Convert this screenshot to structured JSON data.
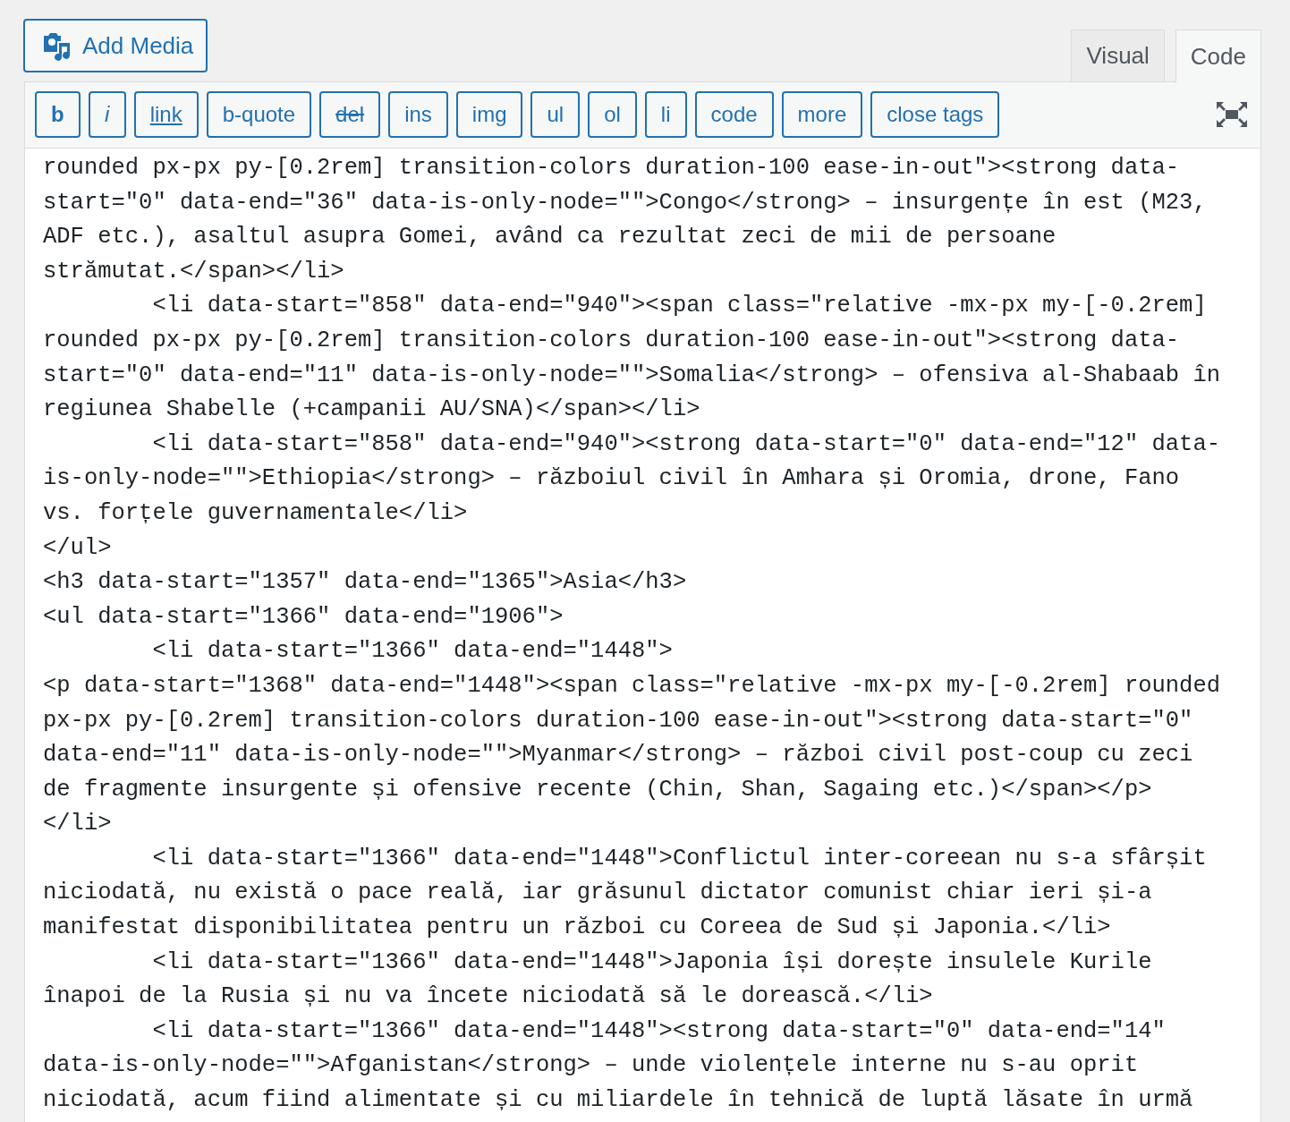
{
  "add_media_button": {
    "label": "Add Media"
  },
  "tabs": [
    {
      "label": "Visual",
      "selected": false
    },
    {
      "label": "Code",
      "selected": true
    }
  ],
  "toolbar": [
    {
      "label": "b",
      "kind": "bold"
    },
    {
      "label": "i",
      "kind": "italic"
    },
    {
      "label": "link",
      "kind": "underline"
    },
    {
      "label": "b-quote",
      "kind": "plain"
    },
    {
      "label": "del",
      "kind": "strike"
    },
    {
      "label": "ins",
      "kind": "plain"
    },
    {
      "label": "img",
      "kind": "plain"
    },
    {
      "label": "ul",
      "kind": "plain"
    },
    {
      "label": "ol",
      "kind": "plain"
    },
    {
      "label": "li",
      "kind": "plain"
    },
    {
      "label": "code",
      "kind": "plain"
    },
    {
      "label": "more",
      "kind": "plain"
    },
    {
      "label": "close tags",
      "kind": "plain"
    }
  ],
  "code_lines": [
    "rounded px-px py-[0.2rem] transition-colors duration-100 ease-in-out\"><strong data-",
    "start=\"0\" data-end=\"36\" data-is-only-node=\"\">Congo</strong> – insurgențe în est (M23,",
    "ADF etc.), asaltul asupra Gomei, având ca rezultat zeci de mii de persoane",
    "strămutat.</span></li>",
    "        <li data-start=\"858\" data-end=\"940\"><span class=\"relative -mx-px my-[-0.2rem]",
    "rounded px-px py-[0.2rem] transition-colors duration-100 ease-in-out\"><strong data-",
    "start=\"0\" data-end=\"11\" data-is-only-node=\"\">Somalia</strong> – ofensiva al-Shabaab în",
    "regiunea Shabelle (+campanii AU/SNA)</span></li>",
    "        <li data-start=\"858\" data-end=\"940\"><strong data-start=\"0\" data-end=\"12\" data-",
    "is-only-node=\"\">Ethiopia</strong> – războiul civil în Amhara și Oromia, drone, Fano",
    "vs. forțele guvernamentale</li>",
    "</ul>",
    "<h3 data-start=\"1357\" data-end=\"1365\">Asia</h3>",
    "<ul data-start=\"1366\" data-end=\"1906\">",
    "        <li data-start=\"1366\" data-end=\"1448\">",
    "<p data-start=\"1368\" data-end=\"1448\"><span class=\"relative -mx-px my-[-0.2rem] rounded",
    "px-px py-[0.2rem] transition-colors duration-100 ease-in-out\"><strong data-start=\"0\"",
    "data-end=\"11\" data-is-only-node=\"\">Myanmar</strong> – război civil post-coup cu zeci",
    "de fragmente insurgente și ofensive recente (Chin, Shan, Sagaing etc.)</span></p>",
    "</li>",
    "        <li data-start=\"1366\" data-end=\"1448\">Conflictul inter-coreean nu s-a sfârșit",
    "niciodată, nu există o pace reală, iar grăsunul dictator comunist chiar ieri și-a",
    "manifestat disponibilitatea pentru un război cu Coreea de Sud și Japonia.</li>",
    "        <li data-start=\"1366\" data-end=\"1448\">Japonia își dorește insulele Kurile",
    "înapoi de la Rusia și nu va încete niciodată să le dorească.</li>",
    "        <li data-start=\"1366\" data-end=\"1448\"><strong data-start=\"0\" data-end=\"14\"",
    "data-is-only-node=\"\">Afganistan</strong> – unde violențele interne nu s-au oprit",
    "niciodată, acum fiind alimentate și cu miliardele în tehnică de luptă lăsate în urmă"
  ]
}
